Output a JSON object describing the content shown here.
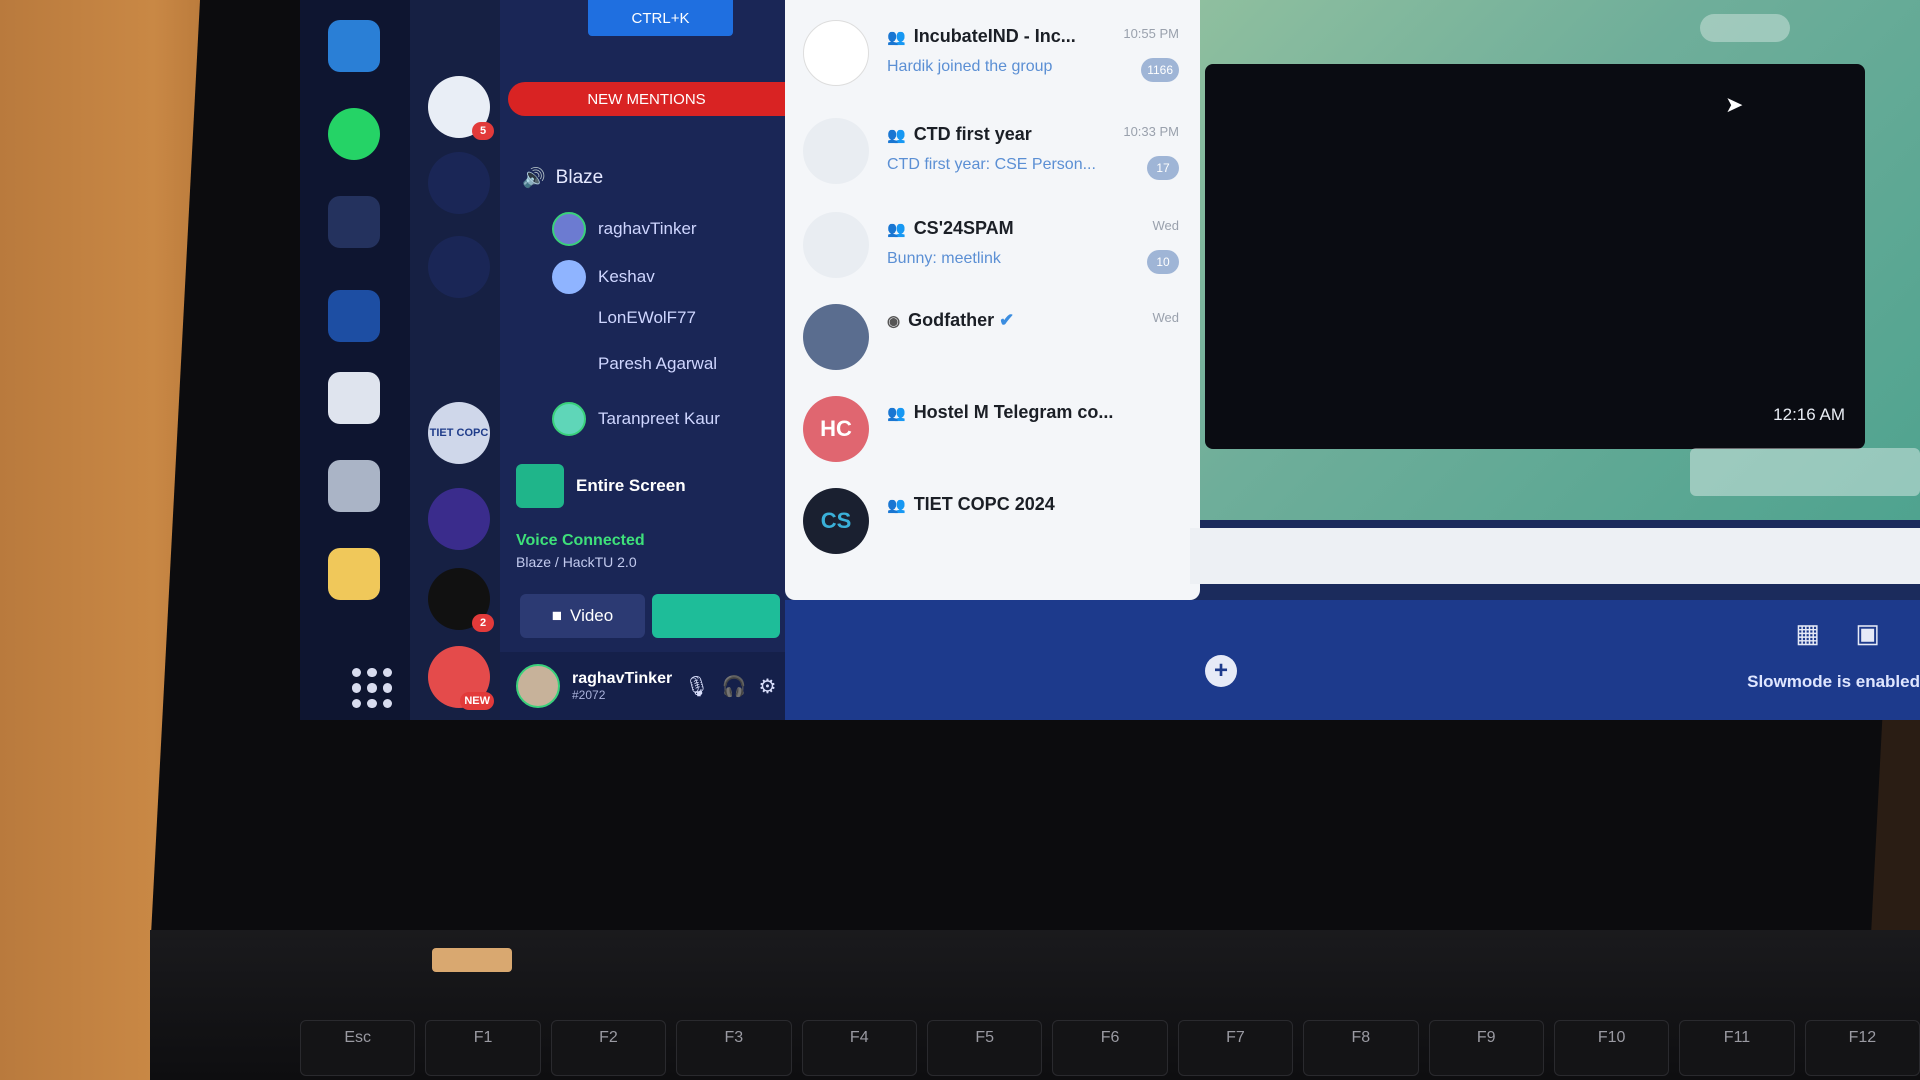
{
  "discord": {
    "shortcut_hint": "CTRL+K",
    "new_mentions": "NEW MENTIONS",
    "voice_channel": "Blaze",
    "members": [
      "raghavTinker",
      "Keshav",
      "LonEWolF77",
      "Paresh Agarwal",
      "Taranpreet Kaur"
    ],
    "share_option": "Entire Screen",
    "voice_status": "Voice Connected",
    "voice_location": "Blaze / HackTU 2.0",
    "video_button": "Video",
    "user_name": "raghavTinker",
    "user_tag": "#2072",
    "slowmode_notice": "Slowmode is enabled",
    "server_badge_new": "NEW",
    "server_label_tiet": "TIET COPC"
  },
  "telegram": {
    "chats": [
      {
        "title": "IncubateIND - Inc...",
        "time": "10:55 PM",
        "preview": "Hardik joined the group",
        "unread": "1166",
        "avatar_color": "#ffffff",
        "avatar_text": ""
      },
      {
        "title": "CTD first year",
        "time": "10:33 PM",
        "preview": "CTD first year: CSE Person...",
        "unread": "17",
        "avatar_color": "#e9edf2",
        "avatar_text": ""
      },
      {
        "title": "CS'24SPAM",
        "time": "Wed",
        "preview": "Bunny: meetlink",
        "unread": "10",
        "avatar_color": "#e9edf2",
        "avatar_text": ""
      },
      {
        "title": "Godfather",
        "time": "Wed",
        "preview": "",
        "unread": "",
        "avatar_color": "#5a6d8f",
        "avatar_text": ""
      },
      {
        "title": "Hostel M Telegram co...",
        "time": "",
        "preview": "",
        "unread": "",
        "avatar_color": "#e06670",
        "avatar_text": "HC"
      },
      {
        "title": "TIET COPC 2024",
        "time": "",
        "preview": "",
        "unread": "",
        "avatar_color": "#1a2030",
        "avatar_text": "CS"
      }
    ],
    "video_timestamp": "12:16 AM"
  },
  "keyboard": {
    "keys": [
      "Esc",
      "F1",
      "F2",
      "F3",
      "F4",
      "F5",
      "F6",
      "F7",
      "F8",
      "F9",
      "F10",
      "F11",
      "F12"
    ]
  },
  "colors": {
    "discord_accent": "#1ebd99",
    "mentions_red": "#d92323",
    "online_green": "#3ad17b"
  }
}
